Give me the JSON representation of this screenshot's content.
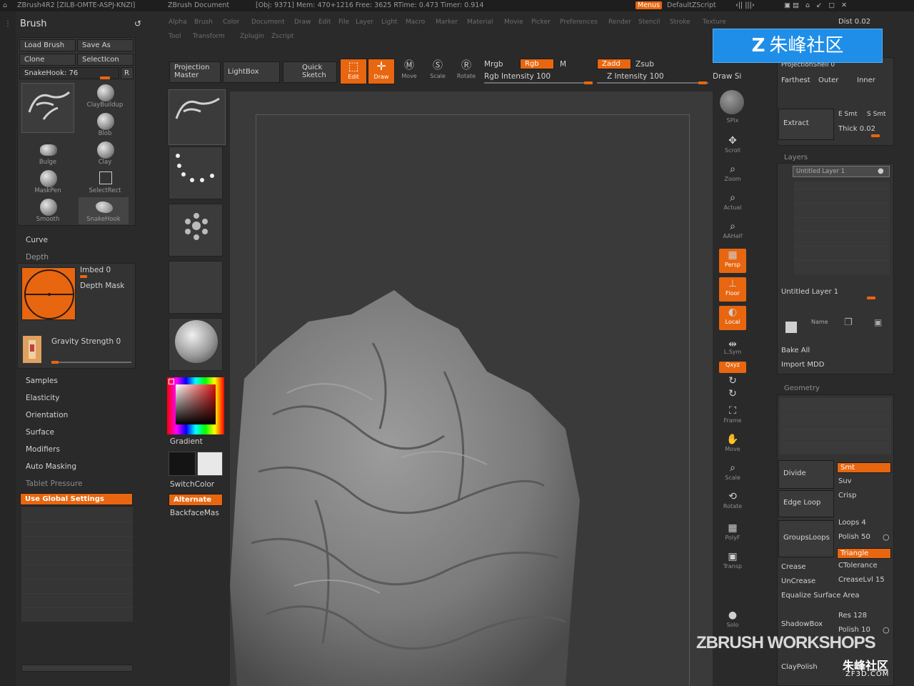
{
  "topbar": {
    "app": "ZBrush4R2 [ZILB-OMTE-ASPJ-KNZI]",
    "doc": "ZBrush Document",
    "stats": "[Obj: 9371] Mem: 470+1216 Free: 3625 RTime: 0.473 Timer: 0.914",
    "menus": "Menus",
    "script": "DefaultZScript"
  },
  "menubar": [
    "Alpha",
    "Brush",
    "Color",
    "Document",
    "Draw",
    "Edit",
    "File",
    "Layer",
    "Light",
    "Macro",
    "Marker",
    "Material",
    "Movie",
    "Picker",
    "Preferences",
    "Render",
    "Stencil",
    "Stroke",
    "Texture",
    "Tool",
    "Transform",
    "Zplugin",
    "Zscript"
  ],
  "brush": {
    "title": "Brush",
    "load": "Load Brush",
    "save": "Save As",
    "clone": "Clone",
    "selicon": "SelectIcon",
    "current": "SnakeHook: 76",
    "r": "R",
    "items": [
      "ClayBuildup",
      "Blob",
      "Bulge",
      "Clay",
      "MaskPen",
      "SelectRect",
      "Smooth",
      "SnakeHook"
    ],
    "curve": "Curve",
    "depth": "Depth",
    "embed": "Imbed 0",
    "depth_mask": "Depth Mask",
    "gravity": "Gravity Strength 0",
    "menus": [
      "Samples",
      "Elasticity",
      "Orientation",
      "Surface",
      "Modifiers",
      "Auto Masking"
    ],
    "tablet": "Tablet Pressure",
    "global": "Use Global Settings"
  },
  "tool_col": {
    "gradient": "Gradient",
    "switch": "SwitchColor",
    "alternate": "Alternate",
    "backface": "BackfaceMas"
  },
  "shelf": {
    "proj": "Projection",
    "master": "Master",
    "lightbox": "LightBox",
    "quick": "Quick",
    "sketch": "Sketch",
    "edit": "Edit",
    "draw": "Draw",
    "move": "Move",
    "scale": "Scale",
    "rotate": "Rotate",
    "mrgb": "Mrgb",
    "rgb": "Rgb",
    "m": "M",
    "rgb_int": "Rgb Intensity 100",
    "zadd": "Zadd",
    "zsub": "Zsub",
    "z_int": "Z Intensity 100",
    "draw_size": "Draw Si"
  },
  "rshelf": [
    "SPix",
    "Scroll",
    "Zoom",
    "Actual",
    "AAHalf",
    "Persp",
    "Floor",
    "Local",
    "L.Sym",
    "Qxyz",
    "Frame",
    "Move",
    "Scale",
    "Rotate",
    "PolyF",
    "Transp",
    "Solo"
  ],
  "rpanel": {
    "dist": "Dist 0.02",
    "projshell": "ProjectionShell 0",
    "farthest": "Farthest",
    "outer": "Outer",
    "inner": "Inner",
    "extract": "Extract",
    "esmt": "E Smt",
    "ssmt": "S Smt",
    "thick": "Thick 0.02",
    "layers": "Layers",
    "untitled": "Untitled Layer 1",
    "untitled2": "Untitled Layer 1",
    "name": "Name",
    "bake": "Bake All",
    "import": "Import MDD",
    "geometry": "Geometry",
    "divide": "Divide",
    "smt": "Smt",
    "suv": "Suv",
    "edgeloop": "Edge Loop",
    "crisp": "Crisp",
    "groupsloops": "GroupsLoops",
    "loops": "Loops 4",
    "polish": "Polish 50",
    "triangle": "Triangle",
    "crease": "Crease",
    "ctol": "CTolerance",
    "uncrease": "UnCrease",
    "creaselvl": "CreaseLvl 15",
    "equalize": "Equalize Surface Area",
    "shadowbox": "ShadowBox",
    "res": "Res 128",
    "polish2": "Polish 10",
    "claypol": "ClayPolish"
  },
  "watermark": "朱峰社区",
  "zbw": "ZBRUSH WORKSHOPS",
  "zf": "朱峰社区",
  "zf_small": "ZF3D.COM",
  "colors": {
    "accent": "#e8660f",
    "bg": "#2a2a2a",
    "panel": "#333333",
    "viewport": "#3a3a3a"
  }
}
